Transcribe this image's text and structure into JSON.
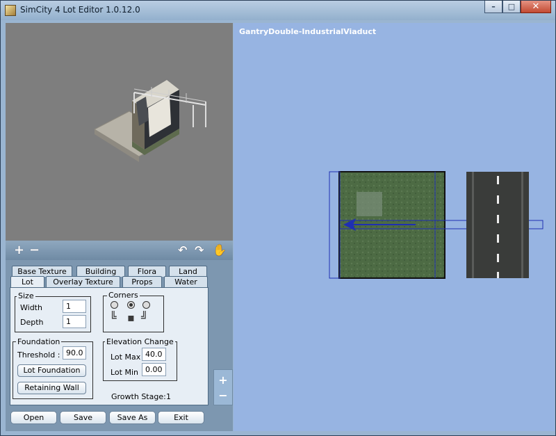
{
  "window": {
    "title": "SimCity 4 Lot Editor 1.0.12.0",
    "minimize_glyph": "–",
    "maximize_glyph": "□",
    "close_glyph": "✕"
  },
  "viewbar": {
    "zoom_in": "+",
    "zoom_out": "−",
    "rotate_left": "↶",
    "rotate_right": "↷",
    "pan_icon": "✋"
  },
  "tabs": {
    "row1": [
      "Base Texture",
      "Building",
      "Flora",
      "Land"
    ],
    "row2": [
      "Lot",
      "Overlay Texture",
      "Props",
      "Water"
    ],
    "active": "Lot"
  },
  "lot": {
    "size": {
      "title": "Size",
      "width_label": "Width",
      "width_value": "1",
      "depth_label": "Depth",
      "depth_value": "1"
    },
    "corners": {
      "title": "Corners"
    },
    "foundation": {
      "title": "Foundation",
      "threshold_label": "Threshold :",
      "threshold_value": "90.0",
      "lot_foundation_btn": "Lot Foundation",
      "retaining_wall_btn": "Retaining Wall"
    },
    "elevation": {
      "title": "Elevation Change",
      "lot_max_label": "Lot Max",
      "lot_max_value": "40.0",
      "lot_min_label": "Lot Min",
      "lot_min_value": "0.00"
    },
    "growth_stage_label": "Growth Stage:",
    "growth_stage_value": "1"
  },
  "bottom_buttons": {
    "open": "Open",
    "save": "Save",
    "save_as": "Save As",
    "exit": "Exit"
  },
  "side_zoom": {
    "plus": "+",
    "minus": "−"
  },
  "editor": {
    "lot_name": "GantryDouble-IndustrialViaduct"
  },
  "colors": {
    "editor_bg": "#97b4e2",
    "lot_grass": "#4d6b44",
    "road_asphalt": "#3a3c3a",
    "selection_blue": "#1f2fb3"
  }
}
